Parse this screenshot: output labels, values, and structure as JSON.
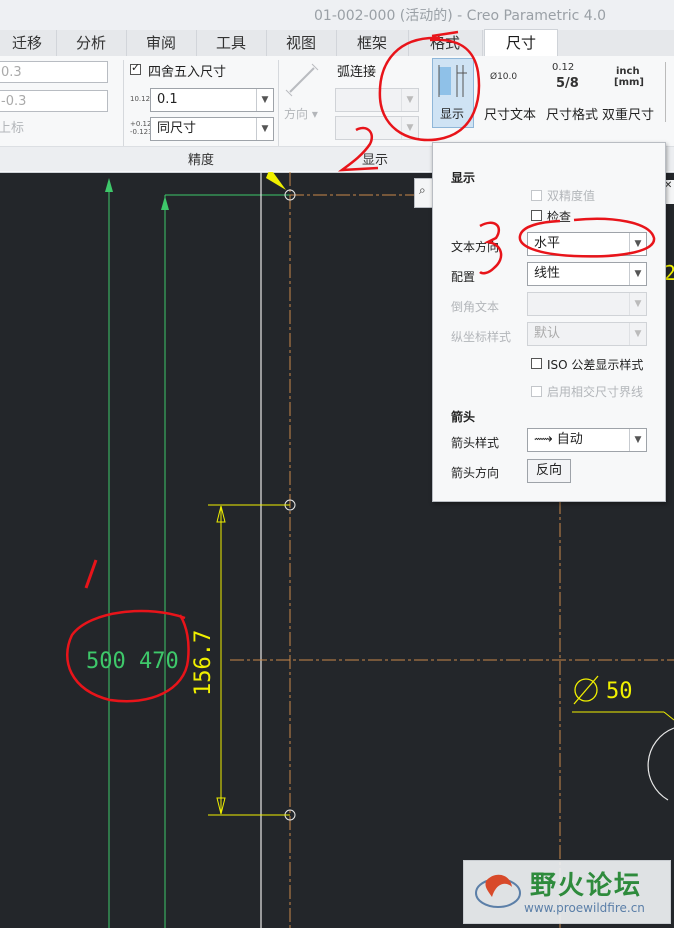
{
  "window": {
    "title": "01-002-000 (活动的) - Creo Parametric 4.0"
  },
  "tabs": [
    {
      "label": "迁移"
    },
    {
      "label": "分析"
    },
    {
      "label": "审阅"
    },
    {
      "label": "工具"
    },
    {
      "label": "视图"
    },
    {
      "label": "框架"
    },
    {
      "label": "格式"
    },
    {
      "label": "尺寸"
    }
  ],
  "ribbon": {
    "tolerance": {
      "upper_value": "0.3",
      "lower_value": "-0.3",
      "label": "上标"
    },
    "precision": {
      "round_label": "四舍五入尺寸",
      "round_checked": true,
      "decimals_icon": "10.123",
      "decimals_value": "0.1",
      "tol_icon_top": "+0.123",
      "tol_icon_bottom": "-0.123",
      "tol_decimals_value": "同尺寸",
      "group_label": "精度"
    },
    "display": {
      "direction_label": "方向",
      "arc_label": "弧连接",
      "show_label": "显示",
      "group_label": "显示"
    },
    "dim_text": {
      "icon_text": "Ø10.0",
      "label": "尺寸文本"
    },
    "dim_format": {
      "icon_top": "0.12",
      "icon_bottom": "5/8",
      "label": "尺寸格式"
    },
    "dual_dim": {
      "icon_top": "inch",
      "icon_bottom": "[mm]",
      "label": "双重尺寸"
    }
  },
  "popup": {
    "section_display": "显示",
    "dual_precision": {
      "label": "双精度值",
      "checked": false
    },
    "inspect": {
      "label": "检查",
      "checked": false
    },
    "text_orientation": {
      "label": "文本方向",
      "value": "水平"
    },
    "configuration": {
      "label": "配置",
      "value": "线性"
    },
    "chamfer_text": {
      "label": "倒角文本",
      "value": ""
    },
    "ordinate_style": {
      "label": "纵坐标样式",
      "value": "默认"
    },
    "iso_tolerance": {
      "label": "ISO 公差显示样式",
      "checked": false
    },
    "intersect_ext": {
      "label": "启用相交尺寸界线",
      "checked": false
    },
    "section_arrow": "箭头",
    "arrow_style": {
      "label": "箭头样式",
      "value": "自动"
    },
    "arrow_direction": {
      "label": "箭头方向",
      "button": "反向"
    }
  },
  "drawing": {
    "dims_text": "500  470",
    "vertical_dim": "156.7",
    "diameter": "50"
  },
  "annotations": {
    "one": "1",
    "two": "2",
    "three": "3"
  },
  "watermark": {
    "name": "野火论坛",
    "url": "www.proewildfire.cn"
  },
  "colors": {
    "canvas_bg": "#23262a",
    "dim_yellow": "#f0f000",
    "dim_green": "#3ec86a",
    "axis_orange": "#c8884a",
    "annotation_red": "#e8141a"
  }
}
